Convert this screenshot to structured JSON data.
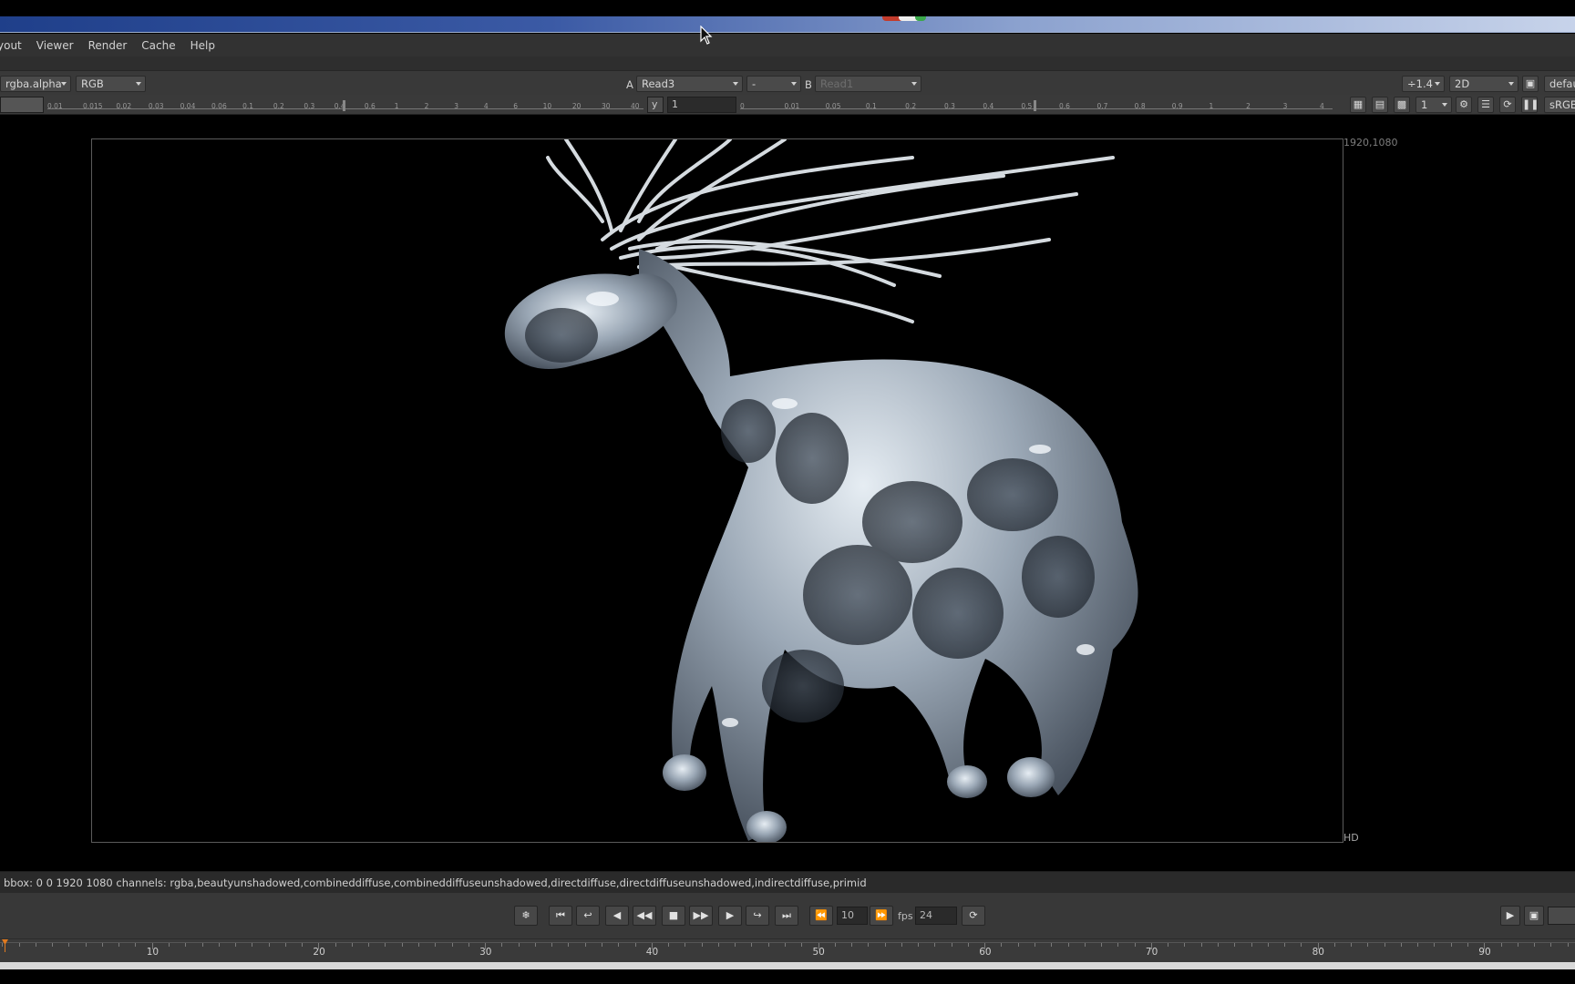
{
  "menu": [
    "yout",
    "Viewer",
    "Render",
    "Cache",
    "Help"
  ],
  "viewer_controls": {
    "layer": "rgba.alpha",
    "display_channels": "RGB",
    "input_a_label": "A",
    "input_a": "Read3",
    "compare_mode": "-",
    "input_b_label": "B",
    "input_b": "Read1",
    "zoom": "÷1.4",
    "view_mode": "2D",
    "lut": "defau"
  },
  "gain_slider": {
    "ticks": [
      "0.01",
      "0.015",
      "0.02",
      "0.03",
      "0.04",
      "0.06",
      "0.1",
      "0.2",
      "0.3",
      "0.4",
      "0.6",
      "1",
      "2",
      "3",
      "4",
      "6",
      "10",
      "20",
      "30",
      "40"
    ],
    "y_label": "y",
    "y_value": "1"
  },
  "gamma_slider": {
    "ticks": [
      "0",
      "0.01",
      "0.05",
      "0.1",
      "0.2",
      "0.3",
      "0.4",
      "0.5",
      "0.6",
      "0.7",
      "0.8",
      "0.9",
      "1",
      "2",
      "3",
      "4"
    ],
    "proxy_value": "1",
    "colorspace": "sRGB"
  },
  "frame": {
    "resolution": "1920,1080",
    "format": "HD"
  },
  "info": "bbox: 0 0 1920 1080 channels: rgba,beautyunshadowed,combineddiffuse,combineddiffuseunshadowed,directdiffuse,directdiffuseunshadowed,indirectdiffuse,primid",
  "transport": {
    "frame_increment": "10",
    "fps_label": "fps",
    "fps": "24"
  },
  "timeline": {
    "labels": [
      "10",
      "20",
      "30",
      "40",
      "50",
      "60",
      "70",
      "80",
      "90"
    ],
    "current_frame": 1
  },
  "colors": {
    "accent_playhead": "#e07a1f",
    "title_gradient_start": "#1f3f8a",
    "title_gradient_end": "#c7d3ea"
  }
}
